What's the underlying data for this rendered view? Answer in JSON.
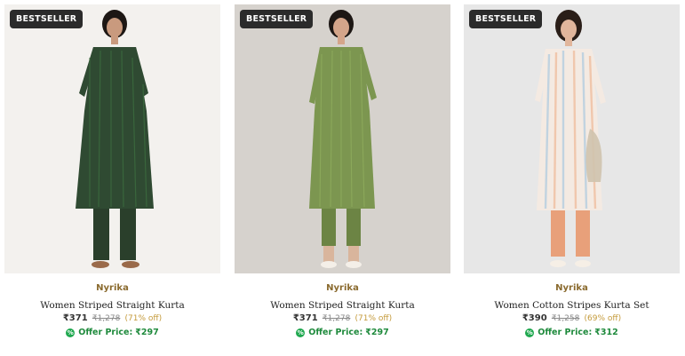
{
  "products": [
    {
      "badge": "BESTSELLER",
      "brand": "Nyrika",
      "title": "Women Striped Straight Kurta",
      "price": "₹371",
      "mrp": "₹1,278",
      "discount": "(71% off)",
      "offer_label": "Offer Price:",
      "offer_price": "₹297",
      "offer_icon": "discount-tag-icon",
      "colors": {
        "bg": "#efece8",
        "kurta": "#2f4a32",
        "pants": "#2a3f2b",
        "accent": "#3c6d3f"
      }
    },
    {
      "badge": "BESTSELLER",
      "brand": "Nyrika",
      "title": "Women Striped Straight Kurta",
      "price": "₹371",
      "mrp": "₹1,278",
      "discount": "(71% off)",
      "offer_label": "Offer Price:",
      "offer_price": "₹297",
      "offer_icon": "discount-tag-icon",
      "colors": {
        "bg": "#d6d2cd",
        "kurta": "#7c9650",
        "pants": "#6c8444",
        "accent": "#8daa5c"
      }
    },
    {
      "badge": "BESTSELLER",
      "brand": "Nyrika",
      "title": "Women Cotton Stripes Kurta Set",
      "price": "₹390",
      "mrp": "₹1,258",
      "discount": "(69% off)",
      "offer_label": "Offer Price:",
      "offer_price": "₹312",
      "offer_icon": "discount-tag-icon",
      "colors": {
        "bg": "#e7e7e7",
        "kurta": "#f4eae2",
        "pants": "#e8a07a",
        "accent": "#b9cfe0"
      }
    }
  ]
}
